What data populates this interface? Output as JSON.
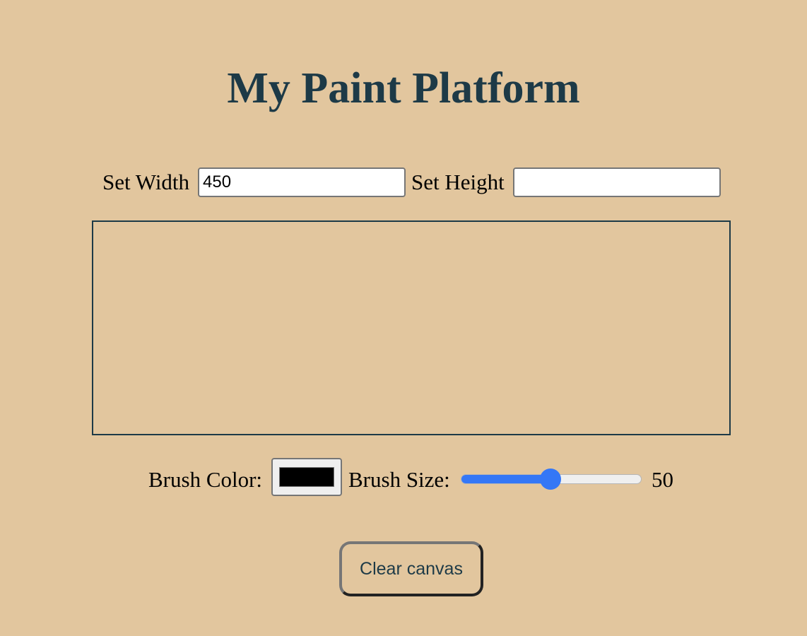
{
  "title": "My Paint Platform",
  "canvas_size": {
    "width_label": "Set Width",
    "width_value": "450",
    "height_label": "Set Height",
    "height_value": ""
  },
  "brush": {
    "color_label": "Brush Color:",
    "color_value": "#000000",
    "size_label": "Brush Size:",
    "size_value": "50",
    "size_min": 1,
    "size_max": 100
  },
  "actions": {
    "clear_label": "Clear canvas"
  },
  "colors": {
    "page_background": "#e2c69e",
    "title_color": "#1d3a47",
    "canvas_border": "#1d3a47",
    "slider_accent": "#3477f6"
  }
}
